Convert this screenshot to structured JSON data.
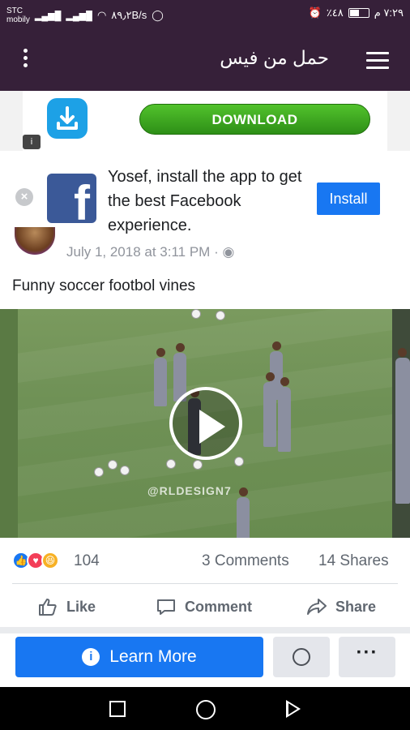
{
  "status_bar": {
    "time": "٧:٢٩ م",
    "battery": "٪٤٨",
    "network_speed": "٨٩٫٢B/s",
    "signal_1": "3G",
    "signal_2": "3G",
    "carrier_top": "STC",
    "carrier_bottom": "mobily"
  },
  "app_bar": {
    "title": "حمل من فيس"
  },
  "ad": {
    "download_label": "DOWNLOAD",
    "info_label": "i"
  },
  "install_prompt": {
    "message": "Yosef, install the app to get the best Facebook experience.",
    "install_label": "Install",
    "close_label": "×",
    "logo_letter": "f"
  },
  "post": {
    "meta": "July 1, 2018 at 3:11 PM · ◉",
    "text": "Funny soccer footbol vines",
    "watermark": "@RLDESIGN7",
    "reactions_count": "104",
    "comments": "3 Comments",
    "shares": "14 Shares"
  },
  "actions": {
    "like": "Like",
    "comment": "Comment",
    "share": "Share"
  },
  "cta": {
    "learn_more": "Learn More",
    "more": "···"
  },
  "colors": {
    "app_bar": "#362039",
    "facebook_blue": "#1877f2",
    "download_green": "#3ea81f"
  }
}
